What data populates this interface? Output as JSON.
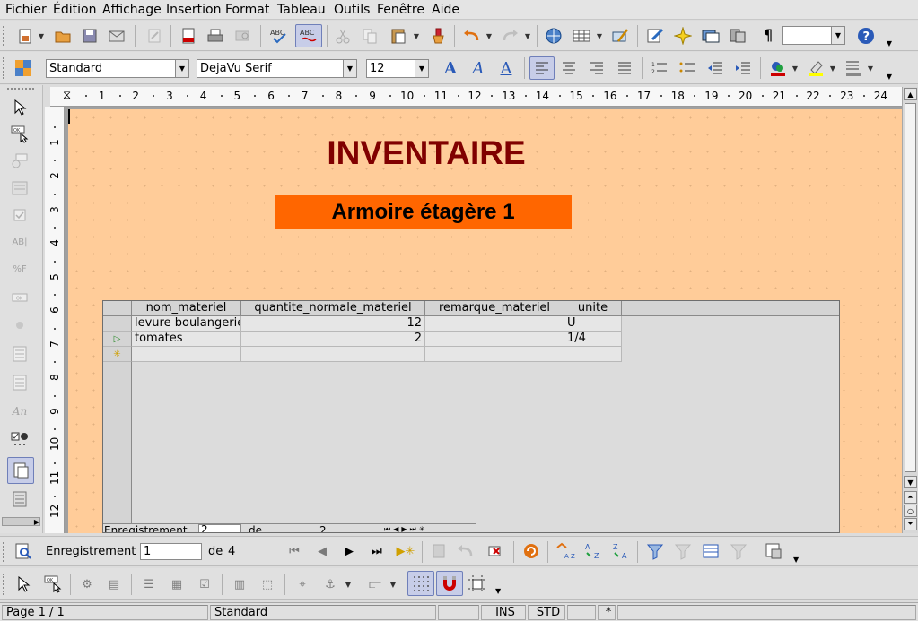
{
  "menu": [
    "Fichier",
    "Édition",
    "Affichage",
    "Insertion",
    "Format",
    "Tableau",
    "Outils",
    "Fenêtre",
    "Aide"
  ],
  "format_toolbar": {
    "style": "Standard",
    "font": "DejaVu Serif",
    "size": "12"
  },
  "ruler_numbers": [
    "1",
    "2",
    "3",
    "4",
    "5",
    "6",
    "7",
    "8",
    "9",
    "10",
    "11",
    "12",
    "13",
    "14",
    "15",
    "16",
    "17",
    "18",
    "19",
    "20",
    "21",
    "22",
    "23",
    "24"
  ],
  "vruler_numbers": [
    "1",
    "2",
    "3",
    "4",
    "5",
    "6",
    "7",
    "8",
    "9",
    "10",
    "11",
    "12"
  ],
  "document": {
    "title": "INVENTAIRE",
    "subtitle": "Armoire étagère 1",
    "grid": {
      "columns": [
        "nom_materiel",
        "quantite_normale_materiel",
        "remarque_materiel",
        "unite"
      ],
      "rows": [
        [
          "levure boulangerie",
          "12",
          "",
          "U"
        ],
        [
          "tomates",
          "2",
          "",
          "1/4"
        ]
      ],
      "navbar": {
        "label": "Enregistrement",
        "record": "2",
        "of_label": "de",
        "total": "2"
      }
    }
  },
  "form_nav": {
    "label": "Enregistrement",
    "record": "1",
    "of_label": "de",
    "total": "4"
  },
  "status": {
    "page": "Page 1 / 1",
    "style": "Standard",
    "ins": "INS",
    "std": "STD",
    "modified": "*"
  },
  "colors": {
    "page_bg": "#ffcc99",
    "title": "#800000",
    "subtitle_bg": "#ff6600"
  }
}
